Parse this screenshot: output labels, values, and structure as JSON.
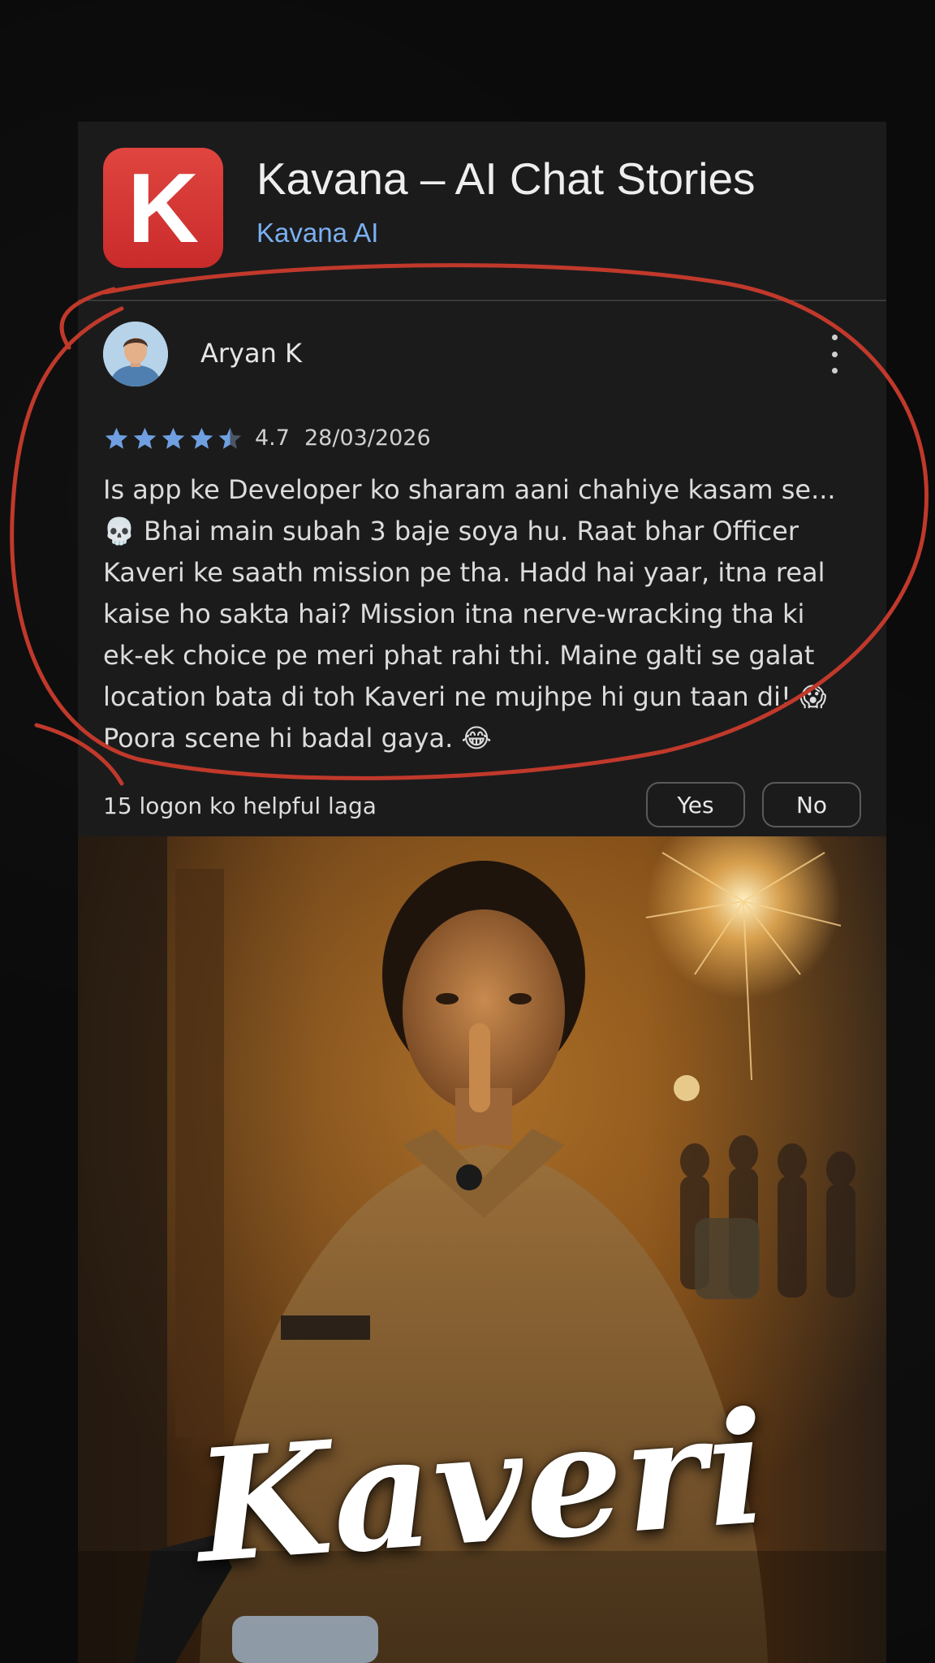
{
  "app": {
    "icon_letter": "K",
    "title": "Kavana – AI Chat Stories",
    "developer": "Kavana AI",
    "accent_color": "#7ab0f0",
    "icon_color": "#d93a36"
  },
  "review": {
    "reviewer_name": "Aryan K",
    "avatar_icon": "person-avatar-icon",
    "menu_icon": "more-vert-icon",
    "stars": 4.5,
    "rating": "4.7",
    "date": "28/03/2026",
    "text_lines": [
      "Is app ke Developer ko sharam aani chahiye kasam se...",
      "💀 Bhai main subah 3 baje soya hu. Raat bhar Officer",
      "Kaveri ke saath mission pe tha. Hadd hai yaar, itna real",
      "kaise ho sakta hai? Mission itna nerve-wracking tha ki",
      "ek-ek choice pe meri phat rahi thi. Maine galti se galat",
      "location bata di toh Kaveri ne mujhpe hi gun taan di! 😱",
      "Poora scene hi badal gaya. 😂"
    ],
    "helpful_text": "15 logon ko helpful laga",
    "yes_label": "Yes",
    "no_label": "No",
    "annotation_color": "#c0392b"
  },
  "poster": {
    "title": "Kaveri"
  }
}
